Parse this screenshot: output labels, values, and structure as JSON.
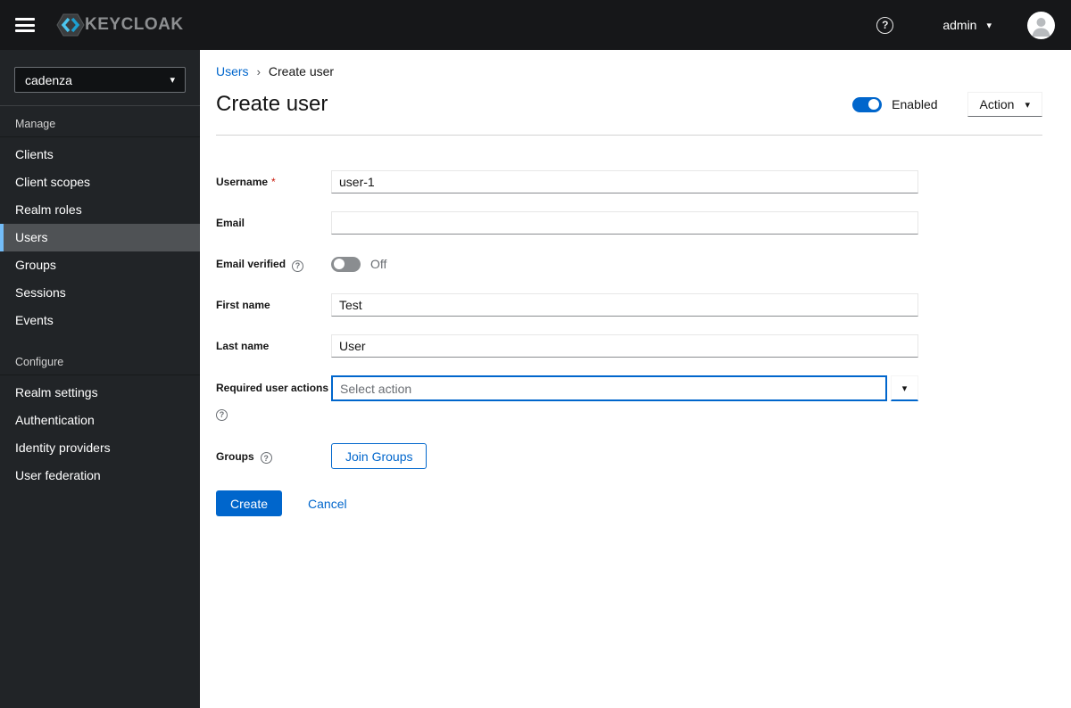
{
  "topbar": {
    "brand": "KEYCLOAK",
    "username": "admin"
  },
  "sidebar": {
    "realm": "cadenza",
    "selected": "Users",
    "sections": [
      {
        "label": "Manage",
        "items": [
          "Clients",
          "Client scopes",
          "Realm roles",
          "Users",
          "Groups",
          "Sessions",
          "Events"
        ]
      },
      {
        "label": "Configure",
        "items": [
          "Realm settings",
          "Authentication",
          "Identity providers",
          "User federation"
        ]
      }
    ]
  },
  "breadcrumb": {
    "items": [
      "Users",
      "Create user"
    ]
  },
  "header": {
    "title": "Create user",
    "enabled_label": "Enabled",
    "action_label": "Action"
  },
  "form": {
    "username": {
      "label": "Username",
      "required": "*",
      "value": "user-1"
    },
    "email": {
      "label": "Email",
      "value": ""
    },
    "email_verified": {
      "label": "Email verified",
      "state": "Off"
    },
    "first_name": {
      "label": "First name",
      "value": "Test"
    },
    "last_name": {
      "label": "Last name",
      "value": "User"
    },
    "required_user_actions": {
      "label": "Required user actions",
      "placeholder": "Select action"
    },
    "groups": {
      "label": "Groups",
      "button": "Join Groups"
    },
    "actions": {
      "create": "Create",
      "cancel": "Cancel"
    }
  },
  "icons": {
    "caret_down": "▾",
    "breadcrumb_separator": "›",
    "help": "?"
  },
  "colors": {
    "primary": "#0066cc",
    "topbar_bg": "#161719",
    "sidebar_bg": "#212427",
    "selected_nav_border": "#73bcf7",
    "required_red": "#c9190b",
    "brand_cyan": "#2db3e2"
  }
}
